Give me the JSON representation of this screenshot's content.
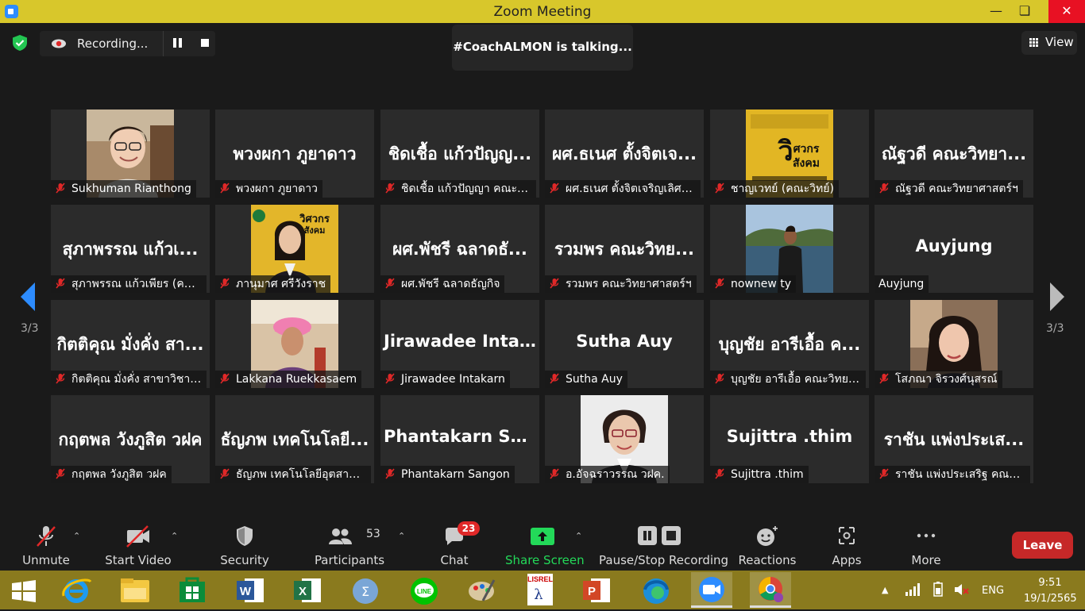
{
  "window": {
    "title": "Zoom Meeting"
  },
  "recording": {
    "label": "Recording..."
  },
  "speaker": {
    "text": "#CoachALMON is talking..."
  },
  "view": {
    "label": "View"
  },
  "gallery": {
    "page": "3/3",
    "tiles": [
      {
        "big": "",
        "name": "Sukhuman Rianthong",
        "muted": true,
        "photo": "woman-glasses"
      },
      {
        "big": "พวงผกา ภูยาดาว",
        "name": "พวงผกา ภูยาดาว",
        "muted": true
      },
      {
        "big": "ชิดเชื้อ แก้วปัญญ...",
        "name": "ชิดเชื้อ แก้วปัญญา คณะวิท...",
        "muted": true
      },
      {
        "big": "ผศ.ธเนศ ตั้งจิตเจ...",
        "name": "ผศ.ธเนศ ตั้งจิตเจริญเลิศ ค...",
        "muted": true
      },
      {
        "big": "",
        "name": "ชาญเวทย์ (คณะวิทย์)",
        "muted": true,
        "photo": "poster",
        "poster_text": "วิศวกร สังคม"
      },
      {
        "big": "ณัฐวดี คณะวิทยา...",
        "name": "ณัฐวดี คณะวิทยาศาสตร์ฯ",
        "muted": true
      },
      {
        "big": "สุภาพรรณ แก้วเ...",
        "name": "สุภาพรรณ แก้วเพียร (คณ...",
        "muted": true
      },
      {
        "big": "",
        "name": "ภานุมาศ ศรีวังราช",
        "muted": true,
        "photo": "woman-poster",
        "poster_text": "วิศวกร สังคม"
      },
      {
        "big": "ผศ.พัชรี ฉลาดธั...",
        "name": "ผศ.พัชรี ฉลาดธัญกิจ",
        "muted": true
      },
      {
        "big": "รวมพร คณะวิทย...",
        "name": "รวมพร คณะวิทยาศาสตร์ฯ",
        "muted": true
      },
      {
        "big": "",
        "name": "nownew ty",
        "muted": true,
        "photo": "lake"
      },
      {
        "big": "Auyjung",
        "name": "Auyjung",
        "muted": false
      },
      {
        "big": "กิตติคุณ มั่งคั่ง สา...",
        "name": "กิตติคุณ มั่งคั่ง สาขาวิชาเ...",
        "muted": true
      },
      {
        "big": "",
        "name": "Lakkana Ruekkasaem",
        "muted": true,
        "photo": "pink-cap"
      },
      {
        "big": "Jirawadee Intak...",
        "name": "Jirawadee Intakarn",
        "muted": true
      },
      {
        "big": "Sutha Auy",
        "name": "Sutha Auy",
        "muted": true
      },
      {
        "big": "บุญชัย อารีเอื้อ ค...",
        "name": "บุญชัย อารีเอื้อ คณะวิทยาศ...",
        "muted": true
      },
      {
        "big": "",
        "name": "โสภณา จิรวงศ์นุสรณ์",
        "muted": true,
        "photo": "woman-portrait"
      },
      {
        "big": "กฤตพล วังภูสิต วฝค",
        "name": "กฤตพล วังภูสิต วฝค",
        "muted": true
      },
      {
        "big": "ธัญภพ เทคโนโลยี...",
        "name": "ธัญภพ เทคโนโลยีอุตสาหก...",
        "muted": true
      },
      {
        "big": "Phantakarn San...",
        "name": "Phantakarn Sangon",
        "muted": true
      },
      {
        "big": "",
        "name": "อ.อัจฉราวรรณ วฝค.",
        "muted": true,
        "photo": "woman-studio"
      },
      {
        "big": "Sujittra .thim",
        "name": "Sujittra .thim",
        "muted": true
      },
      {
        "big": "ราชัน แพ่งประเส...",
        "name": "ราชัน แพ่งประเสริฐ คณะเท...",
        "muted": true
      }
    ]
  },
  "toolbar": {
    "unmute": "Unmute",
    "start_video": "Start Video",
    "security": "Security",
    "participants": "Participants",
    "participants_count": "53",
    "chat": "Chat",
    "chat_badge": "23",
    "share_screen": "Share Screen",
    "pause_stop": "Pause/Stop Recording",
    "reactions": "Reactions",
    "apps": "Apps",
    "more": "More",
    "leave": "Leave"
  },
  "taskbar": {
    "apps": [
      "start",
      "internet-explorer",
      "file-explorer",
      "store",
      "word",
      "excel",
      "calculator",
      "line",
      "paint",
      "lisrel",
      "powerpoint",
      "edge",
      "zoom",
      "chrome"
    ],
    "lang": "ENG",
    "time": "9:51",
    "date": "19/1/2565"
  },
  "colors": {
    "titlebar": "#d8c72b",
    "leave": "#c62828",
    "share_green": "#23d959",
    "taskbar": "#8a7a1e",
    "mute_red": "#e02828"
  }
}
